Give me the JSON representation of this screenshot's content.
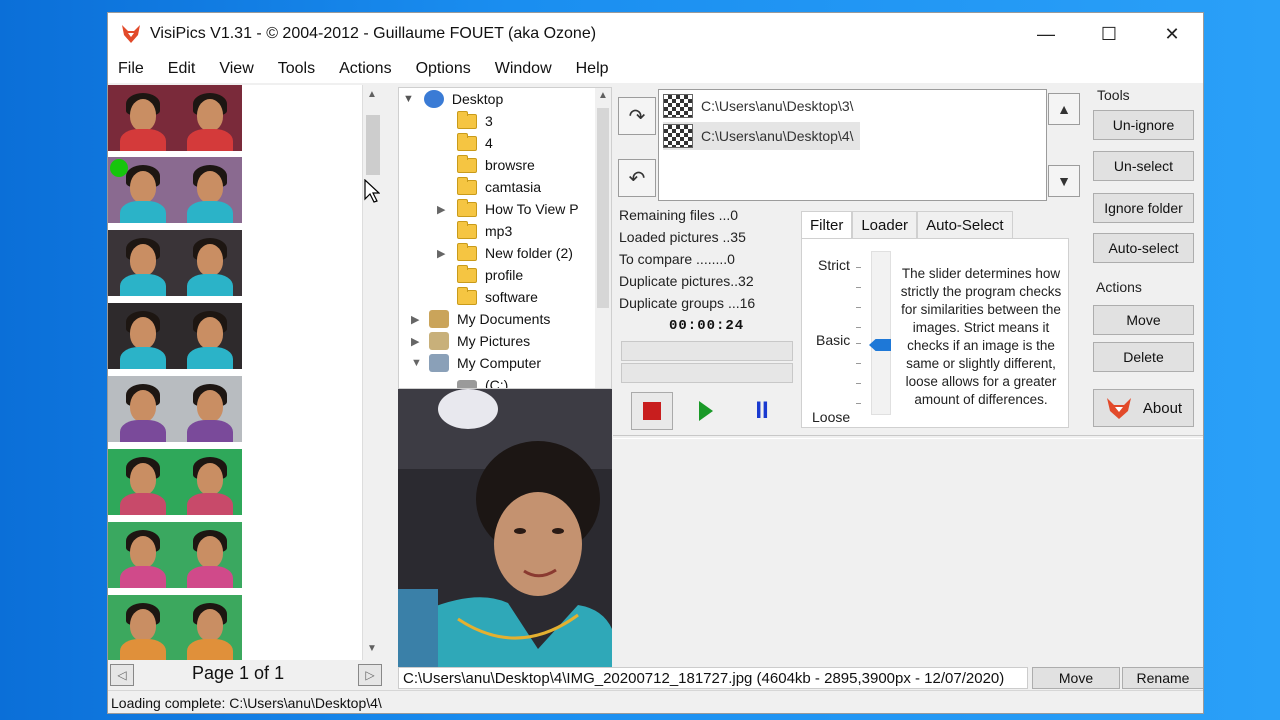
{
  "window": {
    "title": "VisiPics V1.31 - © 2004-2012 - Guillaume FOUET (aka Ozone)",
    "controls": {
      "minimize": "—",
      "maximize": "☐",
      "close": "✕"
    }
  },
  "menu": [
    "File",
    "Edit",
    "View",
    "Tools",
    "Actions",
    "Options",
    "Window",
    "Help"
  ],
  "pager": {
    "label": "Page 1 of 1"
  },
  "tree": {
    "root": "Desktop",
    "folders": [
      "3",
      "4",
      "browsre",
      "camtasia",
      "How To View P",
      "mp3",
      "New folder (2)",
      "profile",
      "software"
    ],
    "others": [
      "My Documents",
      "My Pictures",
      "My Computer"
    ],
    "drive": "(C:)"
  },
  "folderlist": {
    "items": [
      "C:\\Users\\anu\\Desktop\\3\\",
      "C:\\Users\\anu\\Desktop\\4\\"
    ]
  },
  "stats": {
    "remaining": "Remaining files ...0",
    "loaded": "Loaded pictures ..35",
    "to_compare": "To compare ........0",
    "duplicates": "Duplicate pictures..32",
    "groups": "Duplicate groups ...16",
    "timer": "00:00:24"
  },
  "filter": {
    "tabs": [
      "Filter",
      "Loader",
      "Auto-Select"
    ],
    "levels": {
      "strict": "Strict",
      "basic": "Basic",
      "loose": "Loose"
    },
    "slider_level": "Basic",
    "description": "The slider determines how strictly the program checks for similarities between the images. Strict means it checks if an image is the same or slightly different, loose allows for a greater amount of differences."
  },
  "tools": {
    "heading": "Tools",
    "buttons": [
      "Un-ignore",
      "Un-select",
      "Ignore folder",
      "Auto-select"
    ]
  },
  "actions": {
    "heading": "Actions",
    "buttons": [
      "Move",
      "Delete"
    ],
    "about": "About"
  },
  "infobar": {
    "file_info": "C:\\Users\\anu\\Desktop\\4\\IMG_20200712_181727.jpg (4604kb - 2895,3900px - 12/07/2020)",
    "move": "Move",
    "rename": "Rename"
  },
  "status": "Loading complete: C:\\Users\\anu\\Desktop\\4\\",
  "colors": {
    "accent": "#1e78d7",
    "selected_dot": "#16c60c"
  }
}
